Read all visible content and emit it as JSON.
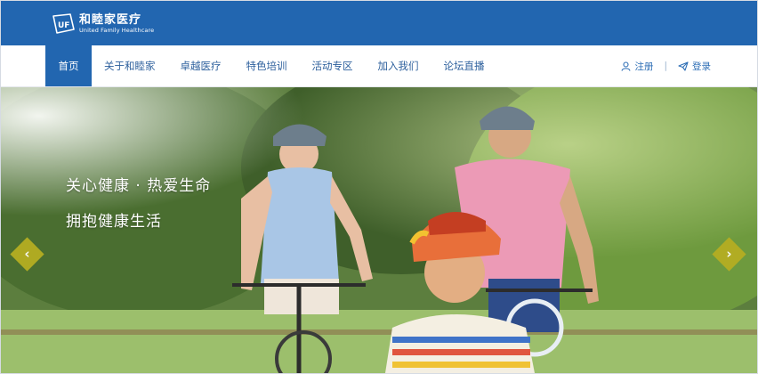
{
  "header": {
    "logo_cn": "和睦家医疗",
    "logo_en": "United Family Healthcare",
    "logo_mark": "UF"
  },
  "nav": {
    "items": [
      {
        "label": "首页",
        "active": true
      },
      {
        "label": "关于和睦家",
        "active": false
      },
      {
        "label": "卓越医疗",
        "active": false
      },
      {
        "label": "特色培训",
        "active": false
      },
      {
        "label": "活动专区",
        "active": false
      },
      {
        "label": "加入我们",
        "active": false
      },
      {
        "label": "论坛直播",
        "active": false
      }
    ]
  },
  "auth": {
    "register_label": "注册",
    "separator": "|",
    "login_label": "登录",
    "register_icon": "user-icon",
    "login_icon": "paper-plane-icon"
  },
  "hero": {
    "slogan_line1": "关心健康 · 热爱生命",
    "slogan_line2": "拥抱健康生活",
    "prev_label": "‹",
    "next_label": "›",
    "image": "family-cycling-photo"
  },
  "colors": {
    "brand_blue": "#2266b0",
    "nav_text": "#2c5f9c",
    "arrow_olive": "#b5ae22"
  }
}
